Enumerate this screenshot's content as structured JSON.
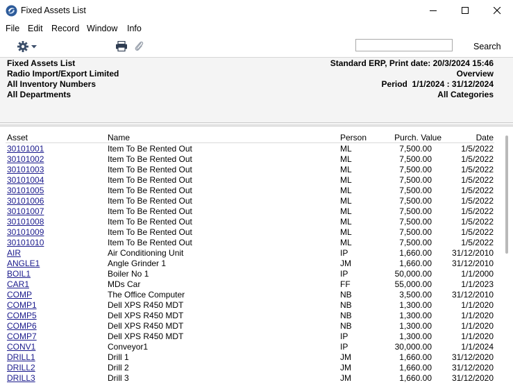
{
  "window": {
    "title": "Fixed Assets List"
  },
  "menu": {
    "items": [
      "File",
      "Edit",
      "Record",
      "Window",
      "Info"
    ]
  },
  "toolbar": {
    "search_label": "Search",
    "search_value": ""
  },
  "header": {
    "left": [
      "Fixed Assets List",
      "Radio Import/Export Limited",
      "All Inventory Numbers",
      "All Departments"
    ],
    "right": [
      "Standard ERP, Print date: 20/3/2024 15:46",
      "Overview",
      "Period  1/1/2024 : 31/12/2024",
      "All Categories"
    ]
  },
  "table": {
    "columns": [
      "Asset",
      "Name",
      "Person",
      "Purch. Value",
      "Date"
    ],
    "rows": [
      [
        "30101001",
        "Item To Be Rented Out",
        "ML",
        "7,500.00",
        "1/5/2022"
      ],
      [
        "30101002",
        "Item To Be Rented Out",
        "ML",
        "7,500.00",
        "1/5/2022"
      ],
      [
        "30101003",
        "Item To Be Rented Out",
        "ML",
        "7,500.00",
        "1/5/2022"
      ],
      [
        "30101004",
        "Item To Be Rented Out",
        "ML",
        "7,500.00",
        "1/5/2022"
      ],
      [
        "30101005",
        "Item To Be Rented Out",
        "ML",
        "7,500.00",
        "1/5/2022"
      ],
      [
        "30101006",
        "Item To Be Rented Out",
        "ML",
        "7,500.00",
        "1/5/2022"
      ],
      [
        "30101007",
        "Item To Be Rented Out",
        "ML",
        "7,500.00",
        "1/5/2022"
      ],
      [
        "30101008",
        "Item To Be Rented Out",
        "ML",
        "7,500.00",
        "1/5/2022"
      ],
      [
        "30101009",
        "Item To Be Rented Out",
        "ML",
        "7,500.00",
        "1/5/2022"
      ],
      [
        "30101010",
        "Item To Be Rented Out",
        "ML",
        "7,500.00",
        "1/5/2022"
      ],
      [
        "AIR",
        "Air Conditioning Unit",
        "IP",
        "1,660.00",
        "31/12/2010"
      ],
      [
        "ANGLE1",
        "Angle Grinder 1",
        "JM",
        "1,660.00",
        "31/12/2010"
      ],
      [
        "BOIL1",
        "Boiler No 1",
        "IP",
        "50,000.00",
        "1/1/2000"
      ],
      [
        "CAR1",
        "MDs Car",
        "FF",
        "55,000.00",
        "1/1/2023"
      ],
      [
        "COMP",
        "The Office Computer",
        "NB",
        "3,500.00",
        "31/12/2010"
      ],
      [
        "COMP1",
        "Dell XPS R450 MDT",
        "NB",
        "1,300.00",
        "1/1/2020"
      ],
      [
        "COMP5",
        "Dell XPS R450 MDT",
        "NB",
        "1,300.00",
        "1/1/2020"
      ],
      [
        "COMP6",
        "Dell XPS R450 MDT",
        "NB",
        "1,300.00",
        "1/1/2020"
      ],
      [
        "COMP7",
        "Dell XPS R450 MDT",
        "IP",
        "1,300.00",
        "1/1/2020"
      ],
      [
        "CONV1",
        "Conveyor1",
        "IP",
        "30,000.00",
        "1/1/2024"
      ],
      [
        "DRILL1",
        "Drill 1",
        "JM",
        "1,660.00",
        "31/12/2020"
      ],
      [
        "DRILL2",
        "Drill 2",
        "JM",
        "1,660.00",
        "31/12/2020"
      ],
      [
        "DRILL3",
        "Drill 3",
        "JM",
        "1,660.00",
        "31/12/2020"
      ]
    ]
  }
}
